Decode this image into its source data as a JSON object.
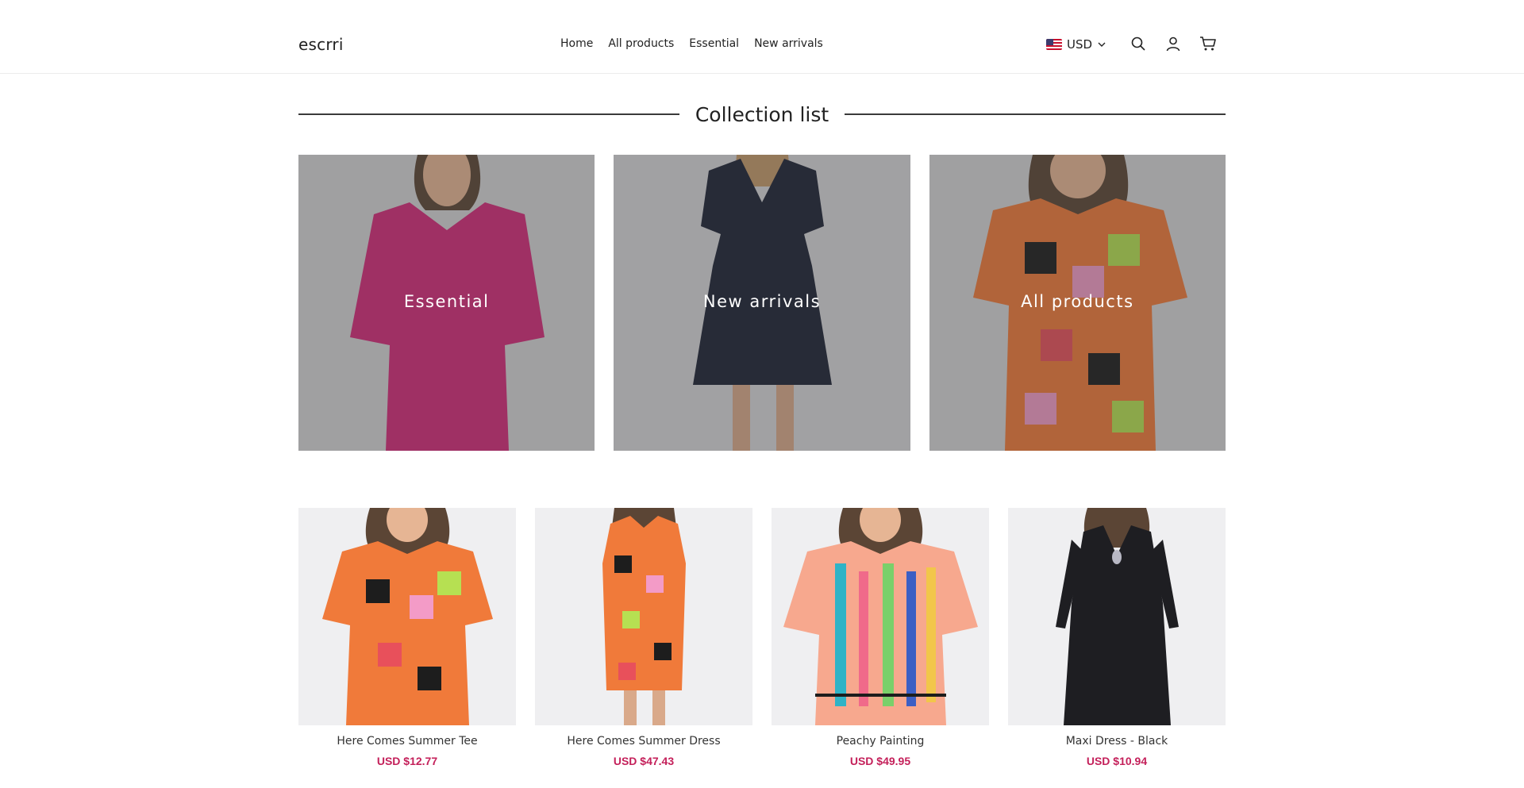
{
  "header": {
    "logo": "escrri",
    "nav": [
      "Home",
      "All products",
      "Essential",
      "New arrivals"
    ],
    "currency": "USD"
  },
  "section": {
    "title": "Collection list"
  },
  "collections": [
    {
      "label": "Essential",
      "garment_color": "#d42a7a"
    },
    {
      "label": "New arrivals",
      "garment_color": "#1d2235"
    },
    {
      "label": "All products",
      "garment_color": "#f07a3a"
    }
  ],
  "products": [
    {
      "name": "Here Comes Summer Tee",
      "price": "USD $12.77"
    },
    {
      "name": "Here Comes Summer Dress",
      "price": "USD $47.43"
    },
    {
      "name": "Peachy Painting",
      "price": "USD $49.95"
    },
    {
      "name": "Maxi Dress - Black",
      "price": "USD $10.94"
    }
  ],
  "colors": {
    "price": "#c4205a",
    "text": "#222222",
    "divider": "#3a3a3a"
  }
}
